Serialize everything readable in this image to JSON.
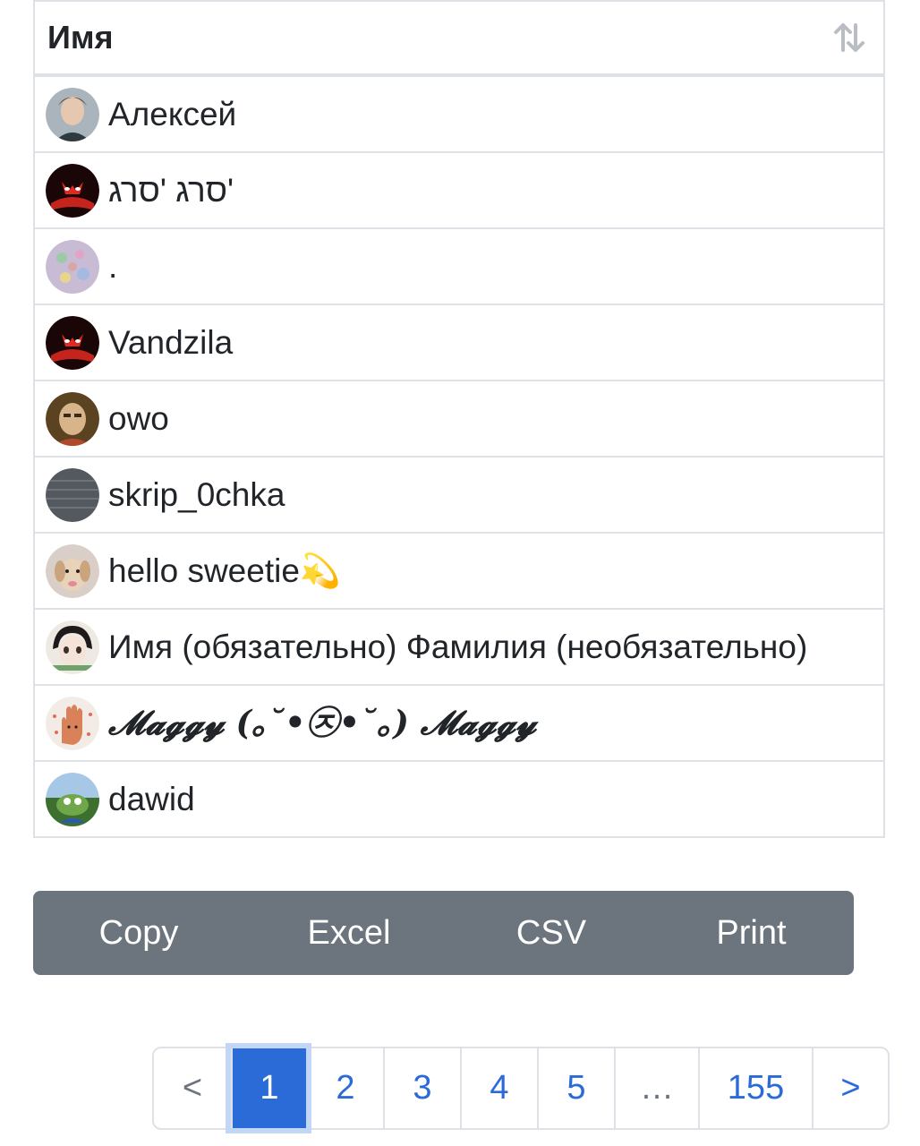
{
  "table": {
    "header": {
      "label": "Имя",
      "sort_icon": "sort-icon"
    },
    "rows": [
      {
        "name": "Алексей",
        "avatar_color": "#7d8a9a"
      },
      {
        "name": "סרג 'סרג'",
        "avatar_color": "#b3201a"
      },
      {
        "name": ".",
        "avatar_color": "#b9a7c9"
      },
      {
        "name": "Vandzila",
        "avatar_color": "#b3201a"
      },
      {
        "name": "owo",
        "avatar_color": "#8a6a3a"
      },
      {
        "name": "skrip_0chka",
        "avatar_color": "#555a60"
      },
      {
        "name": "hello sweetie💫",
        "avatar_color": "#d8c0b0"
      },
      {
        "name": "Имя (обязательно) Фамилия (необязательно)",
        "avatar_color": "#c9c0b6"
      },
      {
        "name": "𝓜𝓪𝓰𝓰𝔂 (｡˘•㉨•˘｡) 𝓜𝓪𝓰𝓰𝔂",
        "avatar_color": "#e07a5a"
      },
      {
        "name": "dawid",
        "avatar_color": "#4f8a3c"
      }
    ]
  },
  "buttons": {
    "copy": "Copy",
    "excel": "Excel",
    "csv": "CSV",
    "print": "Print"
  },
  "pagination": {
    "prev": "<",
    "pages": [
      "1",
      "2",
      "3",
      "4",
      "5"
    ],
    "ellipsis": "…",
    "last": "155",
    "next": ">",
    "active": "1"
  },
  "colors": {
    "primary": "#2a6bd8",
    "secondary": "#6c757d",
    "border": "#dee2e6"
  }
}
